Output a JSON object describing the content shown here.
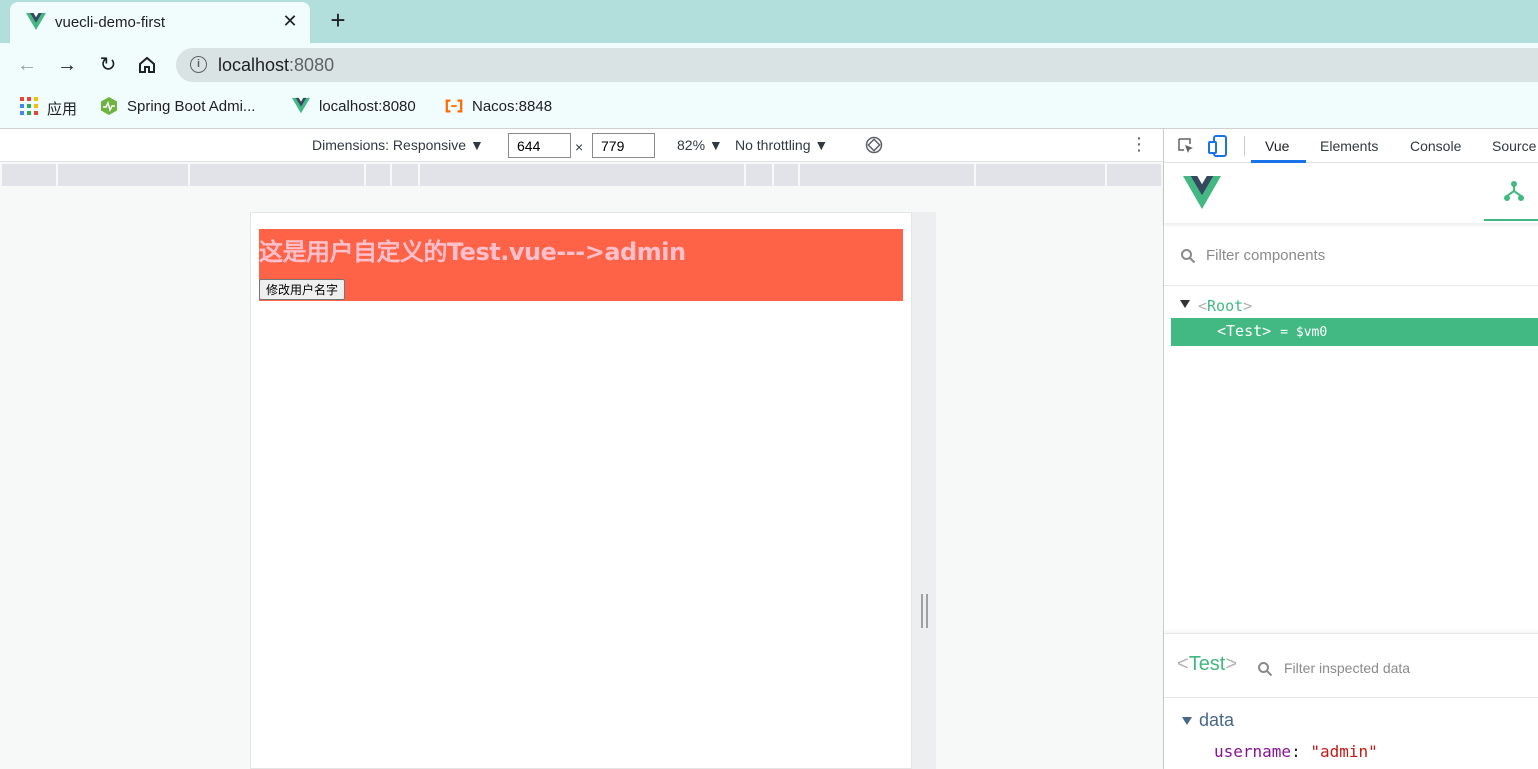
{
  "browser": {
    "tab_title": "vuecli-demo-first",
    "url_host": "localhost",
    "url_port": ":8080"
  },
  "bookmarks": [
    {
      "label": "应用",
      "icon": "apps-grid-icon"
    },
    {
      "label": "Spring Boot Admi...",
      "icon": "spring-boot-admin-icon"
    },
    {
      "label": "localhost:8080",
      "icon": "vue-logo-icon"
    },
    {
      "label": "Nacos:8848",
      "icon": "nacos-icon"
    }
  ],
  "device_toolbar": {
    "dimensions": "Dimensions: Responsive ▼",
    "width": "644",
    "times": "×",
    "height": "779",
    "zoom": "82% ▼",
    "throttling": "No throttling ▼"
  },
  "page": {
    "heading": "这是用户自定义的Test.vue--->admin",
    "button_label": "修改用户名字"
  },
  "devtools": {
    "tabs": [
      "Vue",
      "Elements",
      "Console",
      "Source"
    ],
    "active_tab": "Vue",
    "filter_components_placeholder": "Filter components",
    "tree_root": "Root",
    "tree_selected": "Test",
    "tree_selected_suffix": "= $vm0",
    "inspected_name": "Test",
    "filter_data_placeholder": "Filter inspected data",
    "data_section": "data",
    "data_key": "username",
    "data_value": "\"admin\""
  },
  "colors": {
    "vue_green": "#42b983",
    "component_bg": "#ff6347",
    "heading_color": "#ffc0cb",
    "tab_strip": "#b2dfdb"
  }
}
